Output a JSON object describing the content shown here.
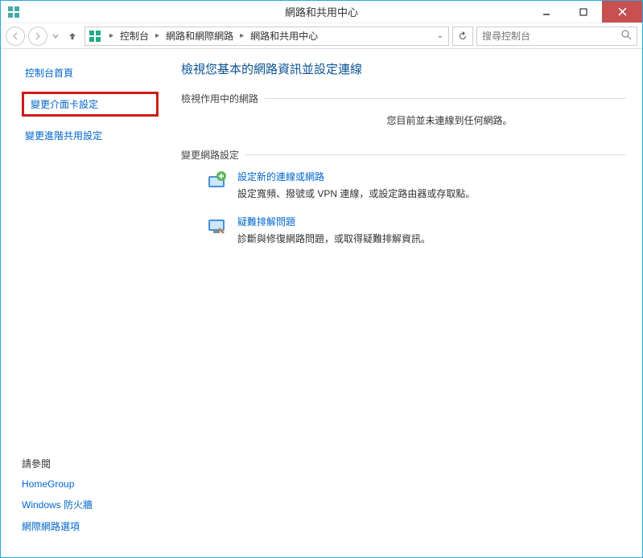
{
  "window": {
    "title": "網路和共用中心"
  },
  "breadcrumb": {
    "items": [
      "控制台",
      "網路和網際網路",
      "網路和共用中心"
    ]
  },
  "search": {
    "placeholder": "搜尋控制台"
  },
  "sidebar": {
    "home": "控制台首頁",
    "adapter": "變更介面卡設定",
    "advanced": "變更進階共用設定",
    "seeAlsoHeading": "請參閱",
    "seeAlso": [
      "HomeGroup",
      "Windows 防火牆",
      "網際網路選項"
    ]
  },
  "main": {
    "heading": "檢視您基本的網路資訊並設定連線",
    "activeNetworksLabel": "檢視作用中的網路",
    "noConnection": "您目前並未連線到任何網路。",
    "changeSettingsLabel": "變更網路設定",
    "newConn": {
      "title": "設定新的連線或網路",
      "desc": "設定寬頻、撥號或 VPN 連線，或設定路由器或存取點。"
    },
    "troubleshoot": {
      "title": "疑難排解問題",
      "desc": "診斷與修復網路問題，或取得疑難排解資訊。"
    }
  }
}
